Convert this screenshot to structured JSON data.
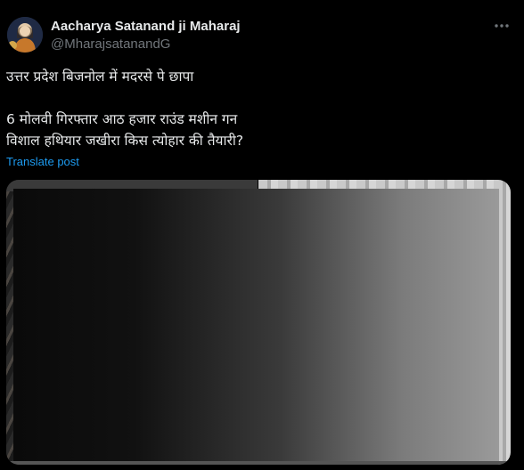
{
  "post": {
    "author": {
      "name": "Aacharya Satanand ji Maharaj",
      "handle": "@MharajsatanandG"
    },
    "text_lines": [
      "उत्तर प्रदेश बिजनोल में मदरसे पे छापा",
      "6 मोलवी गिरफ्तार आठ हजार राउंड मशीन गन",
      "विशाल हथियार जखीरा किस त्योहार की तैयारी?"
    ],
    "translate_label": "Translate post",
    "more_icon": "more-horizontal-icon"
  },
  "colors": {
    "background": "#000000",
    "primary_text": "#e7e9ea",
    "secondary_text": "#71767b",
    "link": "#1d9bf0"
  }
}
